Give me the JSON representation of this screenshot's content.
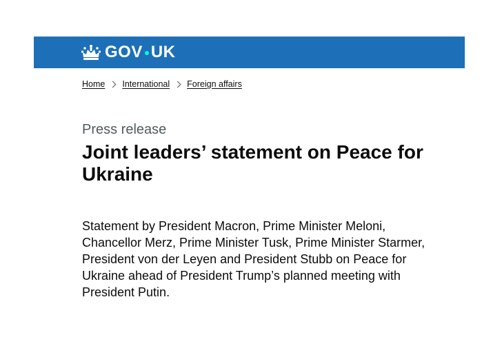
{
  "header": {
    "logo_text_left": "GOV",
    "logo_text_right": "UK",
    "logo_icon": "crown-icon",
    "background_color": "#1d70b8",
    "dot_color": "#00ffe0"
  },
  "breadcrumbs": [
    {
      "label": "Home"
    },
    {
      "label": "International"
    },
    {
      "label": "Foreign affairs"
    }
  ],
  "main": {
    "caption": "Press release",
    "title": "Joint leaders’ statement on Peace for Ukraine",
    "summary": "Statement by President Macron, Prime Minister Meloni, Chancellor Merz, Prime Minister Tusk, Prime Minister Starmer, President von der Leyen and President Stubb on Peace for Ukraine ahead of President Trump’s planned meeting with President Putin."
  }
}
